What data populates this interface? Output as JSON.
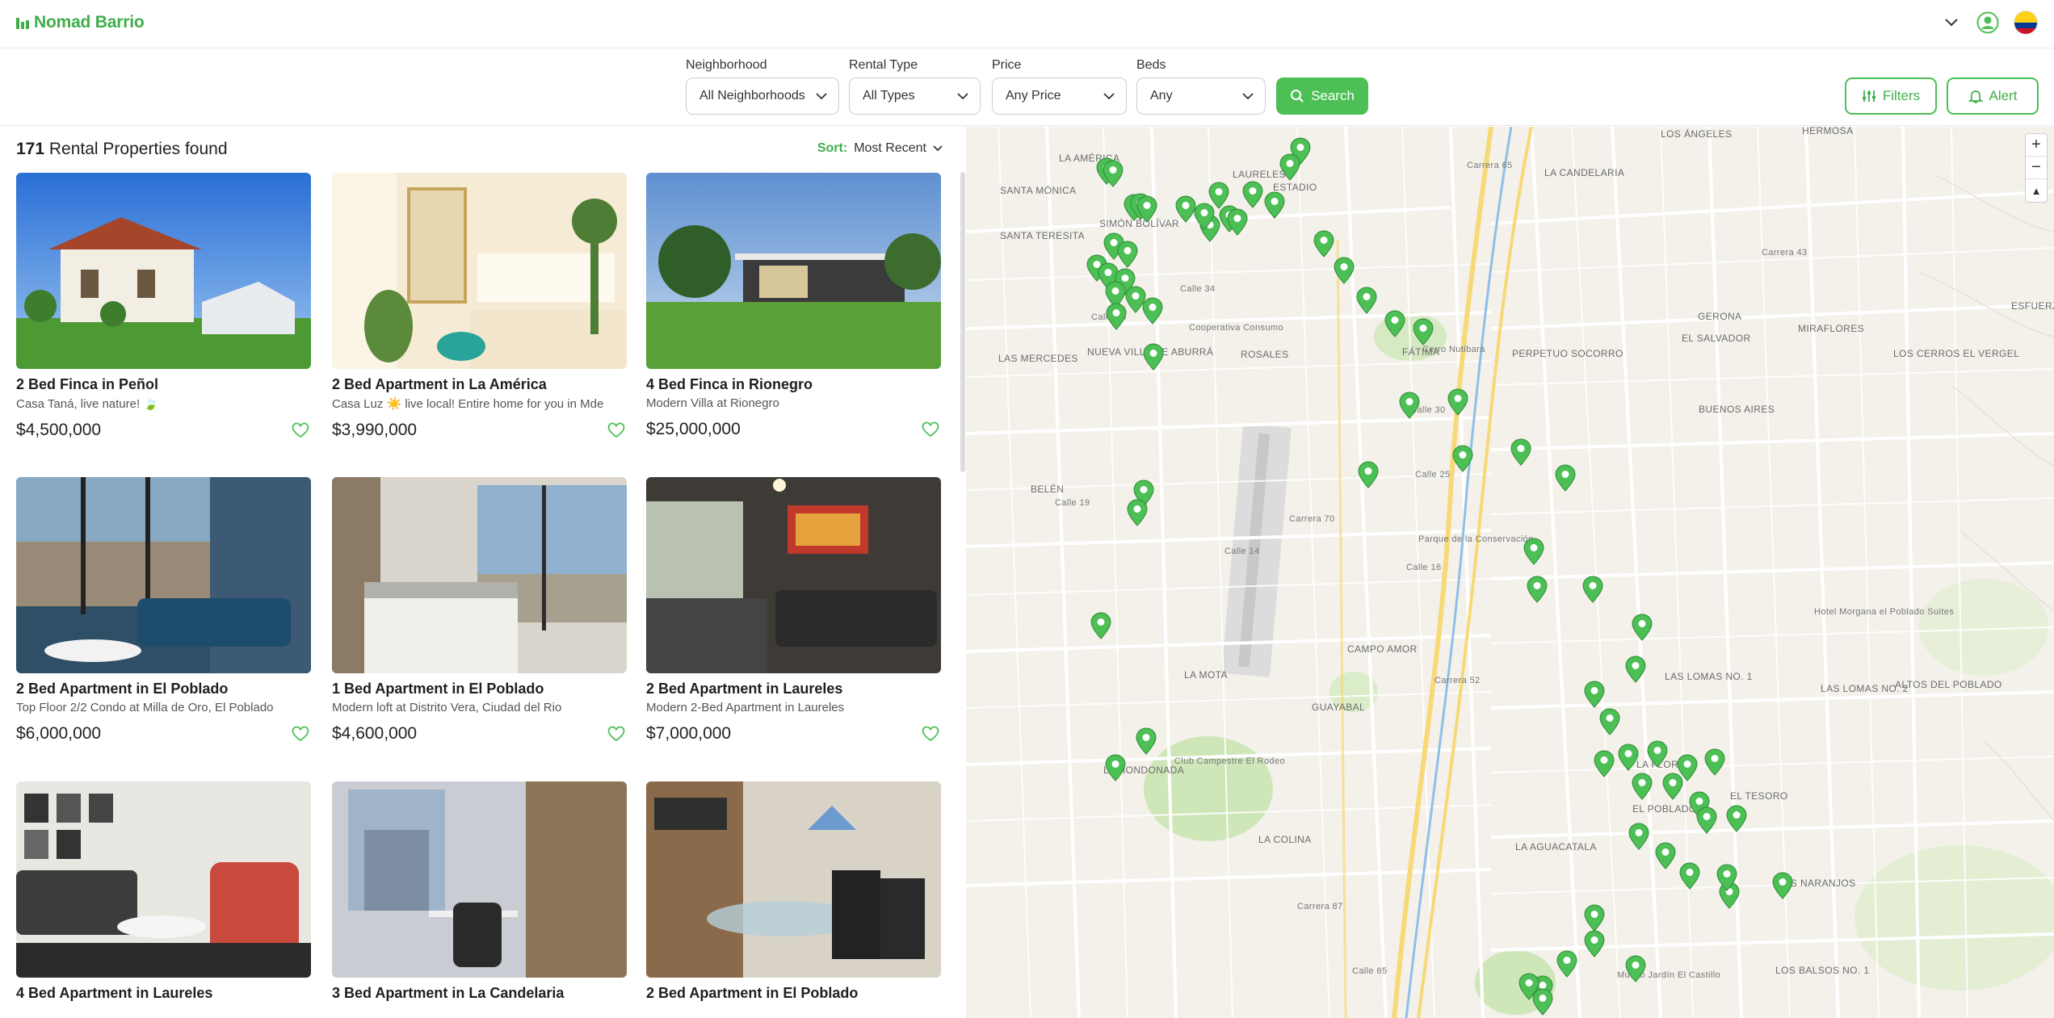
{
  "header": {
    "brand": "Nomad Barrio",
    "icons": [
      "chevron-down-icon",
      "user-icon",
      "colombia-flag-icon"
    ]
  },
  "filters": {
    "neighborhood": {
      "label": "Neighborhood",
      "value": "All Neighborhoods"
    },
    "rental_type": {
      "label": "Rental Type",
      "value": "All Types"
    },
    "price": {
      "label": "Price",
      "value": "Any Price"
    },
    "beds": {
      "label": "Beds",
      "value": "Any"
    },
    "search_label": "Search",
    "filters_label": "Filters",
    "alert_label": "Alert"
  },
  "results": {
    "count": "171",
    "count_suffix": "Rental Properties found",
    "sort_label": "Sort:",
    "sort_value": "Most Recent"
  },
  "listings": [
    {
      "title": "2 Bed Finca in Peñol",
      "subtitle": "Casa Taná, live nature! 🍃",
      "price": "$4,500,000"
    },
    {
      "title": "2 Bed Apartment in La América",
      "subtitle": "Casa Luz ☀️ live local! Entire home for you in Mde",
      "price": "$3,990,000"
    },
    {
      "title": "4 Bed Finca in Rionegro",
      "subtitle": "Modern Villa at Rionegro",
      "price": "$25,000,000"
    },
    {
      "title": "2 Bed Apartment in El Poblado",
      "subtitle": "Top Floor 2/2 Condo at Milla de Oro, El Poblado",
      "price": "$6,000,000"
    },
    {
      "title": "1 Bed Apartment in El Poblado",
      "subtitle": "Modern loft at Distrito Vera, Ciudad del Rio",
      "price": "$4,600,000"
    },
    {
      "title": "2 Bed Apartment in Laureles",
      "subtitle": "Modern 2-Bed Apartment in Laureles",
      "price": "$7,000,000"
    },
    {
      "title": "4 Bed Apartment in Laureles",
      "subtitle": "",
      "price": ""
    },
    {
      "title": "3 Bed Apartment in La Candelaria",
      "subtitle": "",
      "price": ""
    },
    {
      "title": "2 Bed Apartment in El Poblado",
      "subtitle": "",
      "price": ""
    }
  ],
  "map": {
    "zoom_in": "+",
    "zoom_out": "−",
    "compass": "▲",
    "pin_color": "#4cbf55",
    "labels": [
      "LA AMÉRICA",
      "LAURELES",
      "ESTADIO",
      "LA CANDELARIA",
      "LOS ÁNGELES",
      "HERMOSA",
      "SANTA MÓNICA",
      "SIMÓN BOLÍVAR",
      "SANTA TERESITA",
      "LAS MERCEDES",
      "NUEVA VILLA DE ABURRÁ",
      "ROSALES",
      "FÁTIMA",
      "PERPETUO SOCORRO",
      "EL SALVADOR",
      "GERONA",
      "MIRAFLORES",
      "LOS CERROS EL VERGEL",
      "BUENOS AIRES",
      "BELÉN",
      "CAMPO AMOR",
      "LA MOTA",
      "LA HONDONADA",
      "GUAYABAL",
      "LA COLINA",
      "LAS LOMAS NO. 1",
      "LAS LOMAS NO. 2",
      "ALTOS DEL POBLADO",
      "LA FLORIDA",
      "EL POBLADO",
      "EL TESORO",
      "LOS NARANJOS",
      "LOS BALSOS NO. 1",
      "LA AGUACATALA",
      "ESFUERZO DE PAZ",
      "Club Campestre El Rodeo",
      "Parque de la Conservación",
      "Cerro Nutibara",
      "Museo Jardín El Castillo",
      "Hotel Morgana el Poblado Suites",
      "Cooperativa Consumo",
      "Calle 33",
      "Calle 30",
      "Calle 25",
      "Calle 16",
      "Calle 14",
      "Calle 34",
      "Calle 19",
      "Carrera 65",
      "Carrera 70",
      "Carrera 52",
      "Carrera 87",
      "Calle 65",
      "Carrera 43"
    ]
  }
}
